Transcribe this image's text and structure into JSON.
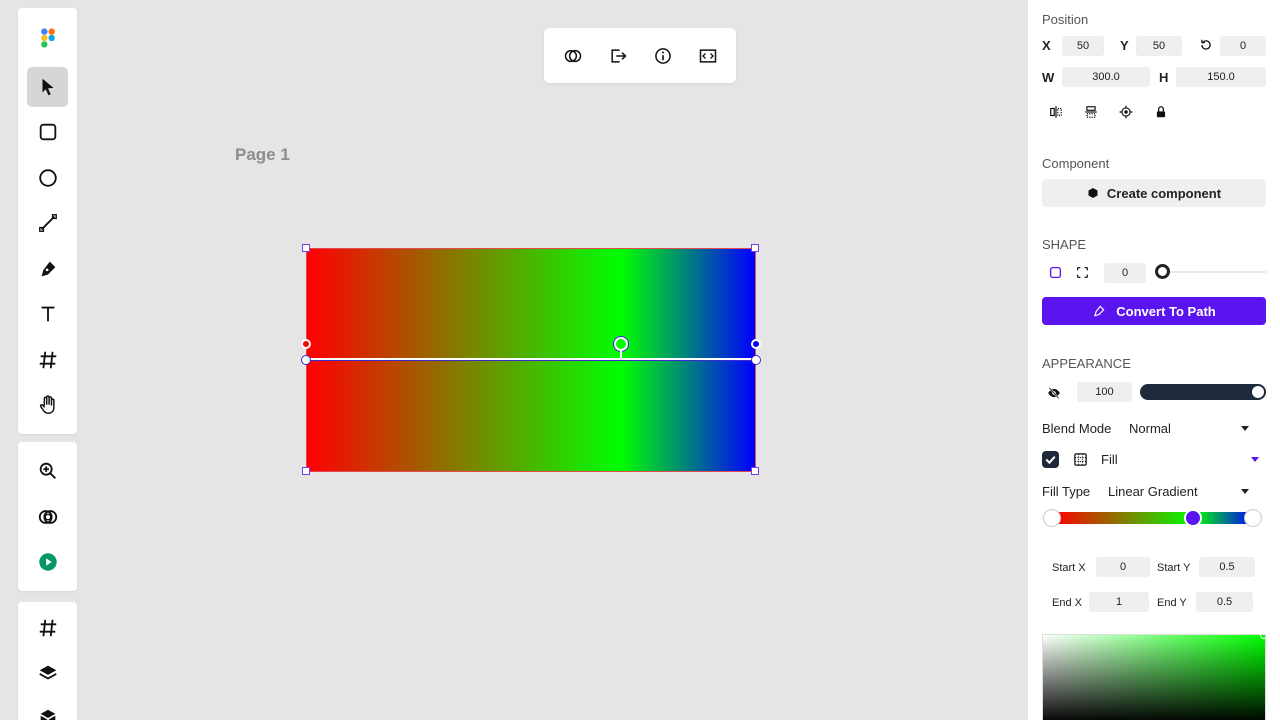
{
  "toolbar": {
    "tools": [
      "move-tool",
      "rectangle-tool",
      "ellipse-tool",
      "line-tool",
      "pen-tool",
      "text-tool",
      "frame-tool",
      "hand-tool"
    ],
    "secondary": [
      "zoom-tool",
      "boolean-tool",
      "play-tool"
    ],
    "tertiary": [
      "frames-tool",
      "layers-tool",
      "components-tool"
    ]
  },
  "float_bar": [
    "boolean-icon",
    "export-icon",
    "info-icon",
    "code-icon"
  ],
  "canvas": {
    "page_label": "Page 1"
  },
  "panel": {
    "position": {
      "title": "Position",
      "x_label": "X",
      "x_value": "50",
      "y_label": "Y",
      "y_value": "50",
      "rotation_value": "0",
      "w_label": "W",
      "w_value": "300.0",
      "h_label": "H",
      "h_value": "150.0"
    },
    "component": {
      "title": "Component",
      "button": "Create component"
    },
    "shape": {
      "title": "SHAPE",
      "radius_value": "0",
      "convert_button": "Convert To Path"
    },
    "appearance": {
      "title": "APPEARANCE",
      "opacity_value": "100",
      "blend_label": "Blend Mode",
      "blend_value": "Normal",
      "fill_label": "Fill",
      "fill_type_label": "Fill Type",
      "fill_type_value": "Linear Gradient",
      "start_x_label": "Start X",
      "start_x_value": "0",
      "start_y_label": "Start Y",
      "start_y_value": "0.5",
      "end_x_label": "End X",
      "end_x_value": "1",
      "end_y_label": "End Y",
      "end_y_value": "0.5"
    }
  },
  "colors": {
    "accent": "#5a14f0",
    "gradient_start": "#ff0000",
    "gradient_mid": "#00ff00",
    "gradient_end": "#0000ff"
  }
}
